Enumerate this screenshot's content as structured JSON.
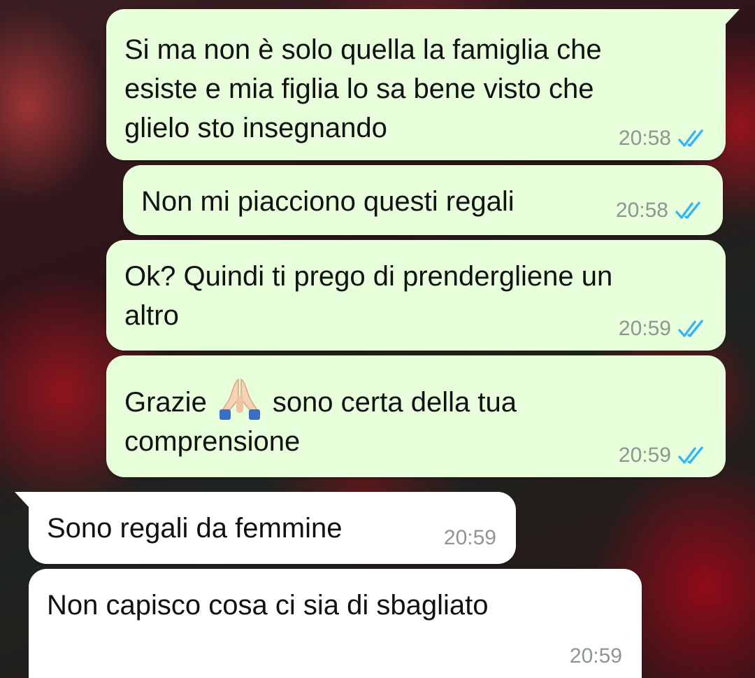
{
  "messages": [
    {
      "direction": "outgoing",
      "text": "Si ma non è solo quella la famiglia che\nesiste e mia figlia lo sa bene visto che\nglielo sto insegnando",
      "time": "20:58",
      "status": "read"
    },
    {
      "direction": "outgoing",
      "text": "Non mi piacciono questi regali",
      "time": "20:58",
      "status": "read"
    },
    {
      "direction": "outgoing",
      "text": "Ok? Quindi ti prego di prendergliene un\naltro",
      "time": "20:59",
      "status": "read"
    },
    {
      "direction": "outgoing",
      "text_before_emoji": "Grazie",
      "emoji": "folded-hands",
      "text_after_emoji": "sono certa della tua\ncomprensione",
      "time": "20:59",
      "status": "read"
    },
    {
      "direction": "incoming",
      "text": "Sono regali da femmine",
      "time": "20:59"
    },
    {
      "direction": "incoming",
      "text": "Non capisco cosa ci sia di sbagliato",
      "time": "20:59"
    }
  ],
  "colors": {
    "outgoing_bubble": "#e7ffdb",
    "incoming_bubble": "#ffffff",
    "read_ticks": "#34b7f1",
    "timestamp": "#8d968f"
  }
}
